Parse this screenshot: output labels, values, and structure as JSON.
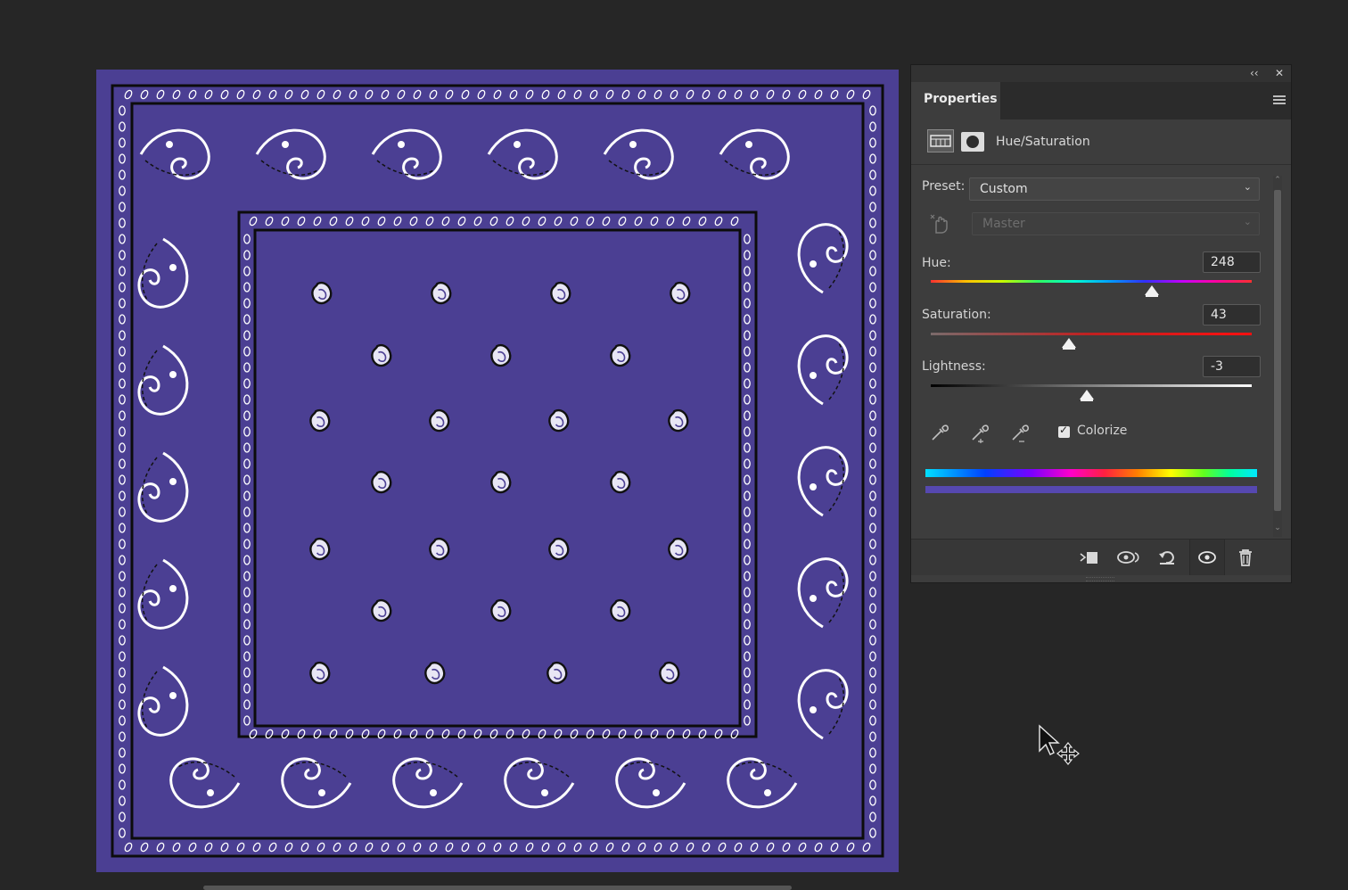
{
  "panel": {
    "collapse_glyph": "‹‹",
    "close_glyph": "✕",
    "tab_label": "Properties",
    "adjustment_title": "Hue/Saturation",
    "preset_label": "Preset:",
    "preset_value": "Custom",
    "channel_value": "Master",
    "hue_label": "Hue:",
    "hue_value": "248",
    "saturation_label": "Saturation:",
    "saturation_value": "43",
    "lightness_label": "Lightness:",
    "lightness_value": "-3",
    "colorize_label": "Colorize",
    "colorize_checked": true,
    "slider_levels": {
      "hue": 0.69,
      "saturation": 0.43,
      "lightness": 0.485
    }
  },
  "colors": {
    "artwork_fill": "#4b3f93",
    "result_bar": "#5648b0",
    "panel_bg": "#3d3d3d",
    "workspace_bg": "#262626"
  },
  "icons": [
    "adjustment-layer-icon",
    "layer-mask-icon",
    "targeted-adjustment-hand-icon",
    "eyedropper-icon",
    "eyedropper-add-icon",
    "eyedropper-subtract-icon",
    "clip-to-layer-icon",
    "view-previous-state-icon",
    "reset-icon",
    "toggle-visibility-icon",
    "delete-icon",
    "panel-menu-icon",
    "move-cursor-icon"
  ]
}
